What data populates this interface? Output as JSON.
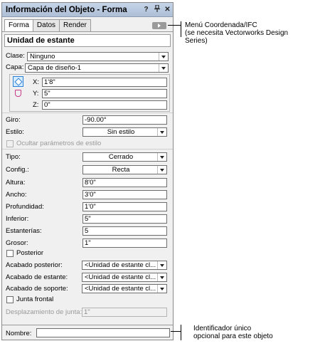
{
  "palette": {
    "title": "Información del Objeto - Forma",
    "title_buttons": [
      "?",
      "Ͱ",
      "✕"
    ],
    "tabs": [
      "Forma",
      "Datos",
      "Render"
    ],
    "object_type": "Unidad de estante",
    "clase": {
      "label": "Clase:",
      "value": "Ninguno"
    },
    "capa": {
      "label": "Capa:",
      "value": "Capa de diseño-1"
    },
    "location": {
      "x": {
        "label": "X:",
        "value": "1'8\""
      },
      "y": {
        "label": "Y:",
        "value": "5\""
      },
      "z": {
        "label": "Z:",
        "value": "0\""
      }
    },
    "giro": {
      "label": "Giro:",
      "value": "-90.00°"
    },
    "estilo": {
      "label": "Estilo:",
      "value": "Sin estilo"
    },
    "ocultar_parametros": {
      "label": "Ocultar parámetros de estilo",
      "checked": false,
      "enabled": false
    },
    "tipo": {
      "label": "Tipo:",
      "value": "Cerrado"
    },
    "config": {
      "label": "Config.:",
      "value": "Recta"
    },
    "altura": {
      "label": "Altura:",
      "value": "8'0\""
    },
    "ancho": {
      "label": "Ancho:",
      "value": "3'0\""
    },
    "profundidad": {
      "label": "Profundidad:",
      "value": "1'0\""
    },
    "inferior": {
      "label": "Inferior:",
      "value": "5\""
    },
    "estanterias": {
      "label": "Estanterías:",
      "value": "5"
    },
    "grosor": {
      "label": "Grosor:",
      "value": "1\""
    },
    "posterior": {
      "label": "Posterior",
      "checked": false
    },
    "acabado_posterior": {
      "label": "Acabado posterior:",
      "value": "<Unidad de estante cl..."
    },
    "acabado_estante": {
      "label": "Acabado de estante:",
      "value": "<Unidad de estante cl..."
    },
    "acabado_soporte": {
      "label": "Acabado de soporte:",
      "value": "<Unidad de estante cl..."
    },
    "junta_frontal": {
      "label": "Junta frontal",
      "checked": false
    },
    "desplazamiento_junta": {
      "label": "Desplazamiento de junta:",
      "value": "1\"",
      "enabled": false
    },
    "nombre": {
      "label": "Nombre:",
      "value": ""
    }
  },
  "annotations": {
    "menu": [
      "Menú Coordenada/IFC",
      "(se necesita Vectorworks Design",
      "Series)"
    ],
    "name": [
      "Identificador único",
      "opcional para este objeto"
    ]
  }
}
